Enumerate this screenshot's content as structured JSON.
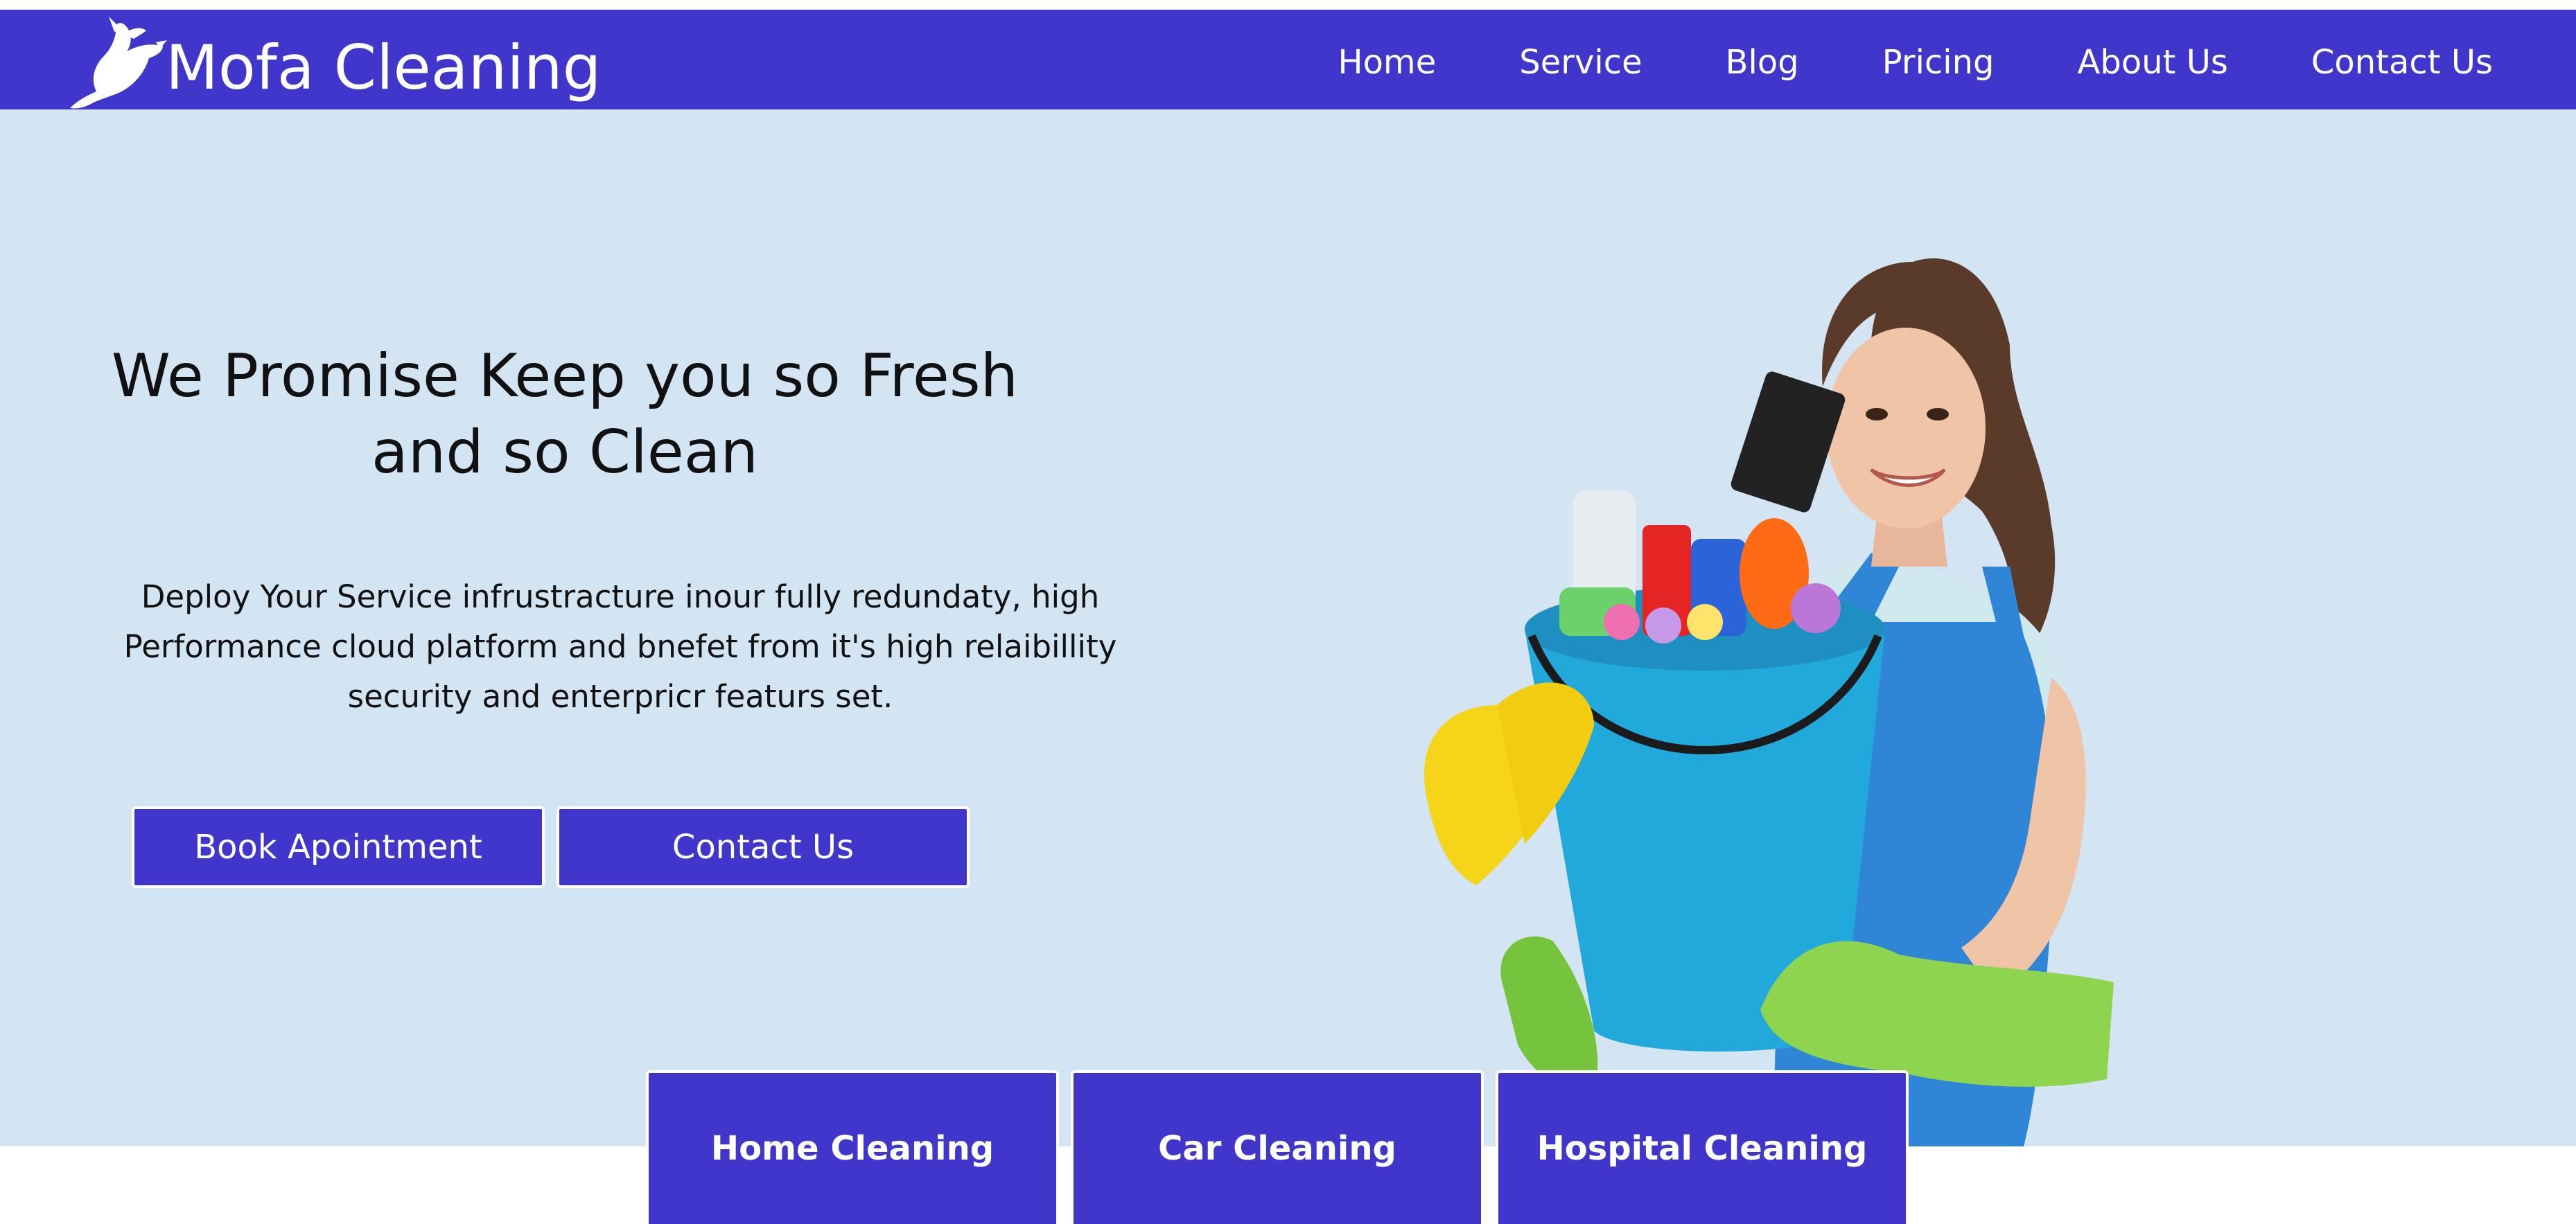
{
  "brand": {
    "name": "Mofa Cleaning",
    "logo_icon": "dove-icon"
  },
  "nav": {
    "items": [
      {
        "label": "Home"
      },
      {
        "label": "Service"
      },
      {
        "label": "Blog"
      },
      {
        "label": "Pricing"
      },
      {
        "label": "About Us"
      },
      {
        "label": "Contact Us"
      }
    ]
  },
  "hero": {
    "title": "We Promise Keep you so Fresh and so Clean",
    "description": "Deploy Your Service infrustracture inour fully redundaty, high Performance cloud platform and bnefet from it's high relaibillity security and enterpricr featurs set.",
    "book_button": "Book Apointment",
    "contact_button": "Contact Us",
    "image": "woman-with-cleaning-bucket-illustration"
  },
  "services": {
    "cards": [
      {
        "label": "Home Cleaning"
      },
      {
        "label": "Car Cleaning"
      },
      {
        "label": "Hospital Cleaning"
      }
    ]
  },
  "colors": {
    "navbar": "#4036cc",
    "hero_background": "#d3e4f3",
    "button": "#4036cc",
    "text": "#111111",
    "white": "#ffffff"
  }
}
